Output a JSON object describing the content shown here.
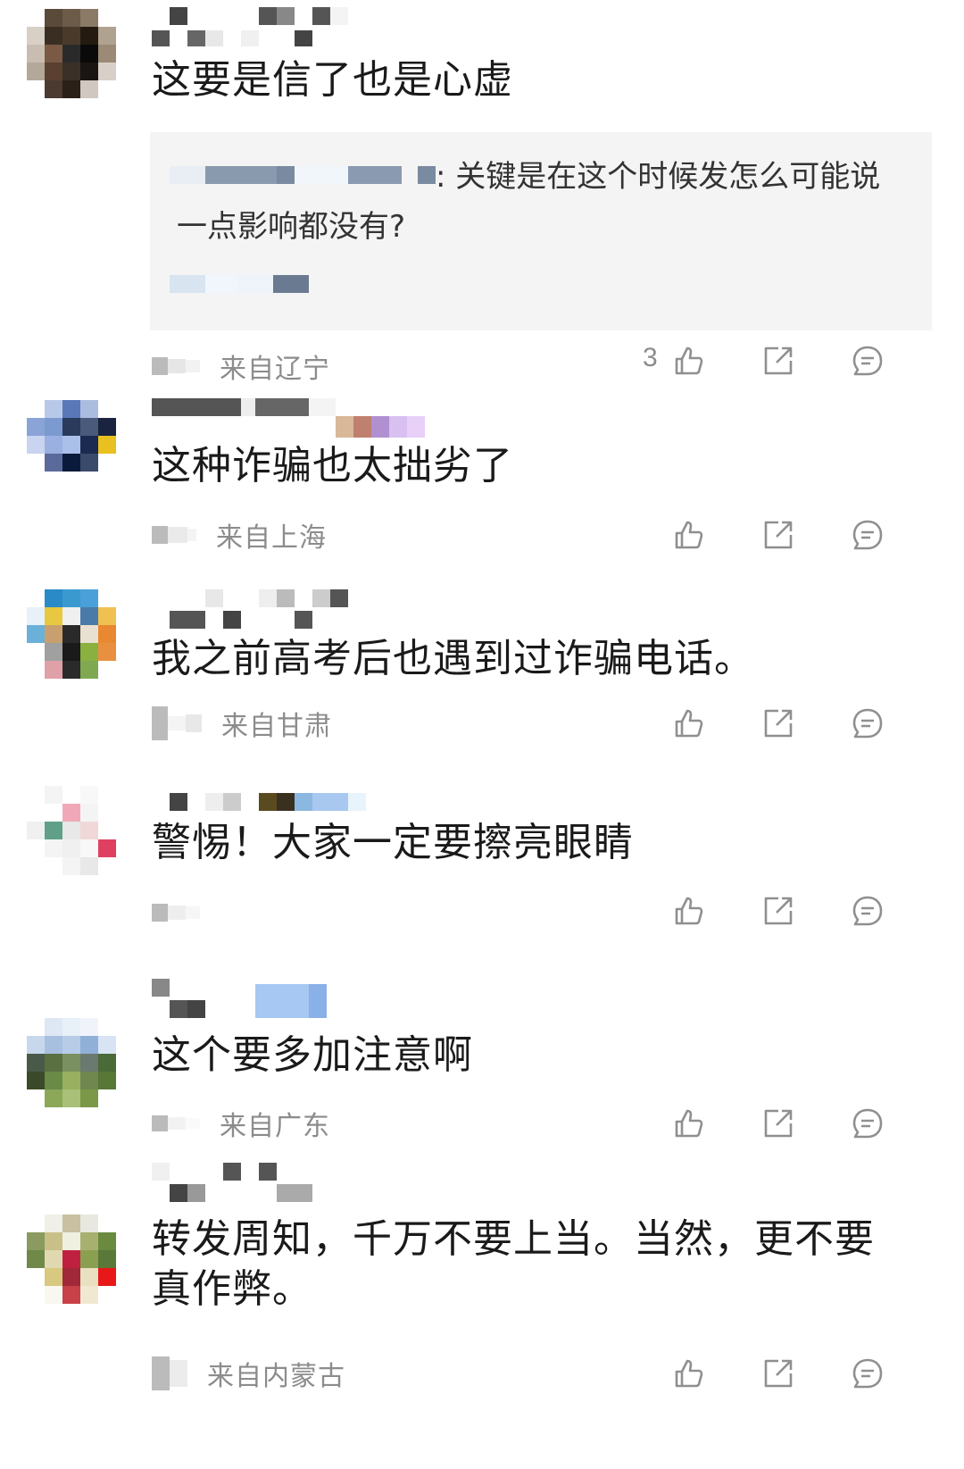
{
  "colors": {
    "text": "#1a1a1a",
    "meta_gray": "#8c8c8c",
    "icon_gray": "#8f8f8f",
    "quote_bg": "#f4f4f4"
  },
  "icons": {
    "like": "thumbs-up-icon",
    "share": "share-icon",
    "comment": "comment-icon"
  },
  "comments": [
    {
      "text": "这要是信了也是心虚",
      "quote": {
        "text": ": 关键是在这个时候发怎么可能说一点影响都没有?"
      },
      "location": "来自辽宁",
      "like_count": "3"
    },
    {
      "text": "这种诈骗也太拙劣了",
      "location": "来自上海",
      "like_count": ""
    },
    {
      "text": "我之前高考后也遇到过诈骗电话。",
      "location": "来自甘肃",
      "like_count": ""
    },
    {
      "text": "警惕！大家一定要擦亮眼睛",
      "location": "",
      "like_count": ""
    },
    {
      "text": "这个要多加注意啊",
      "location": "来自广东",
      "like_count": ""
    },
    {
      "text": "转发周知，千万不要上当。当然，更不要真作弊。",
      "location": "来自内蒙古",
      "like_count": ""
    }
  ]
}
